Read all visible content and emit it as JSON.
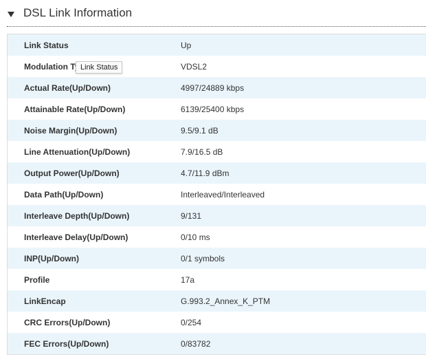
{
  "section": {
    "title": "DSL Link Information",
    "toggle_icon": "triangle-down-icon"
  },
  "rows": [
    {
      "label": "Link Status",
      "value": "Up"
    },
    {
      "label": "Modulation Type",
      "value": "VDSL2"
    },
    {
      "label": "Actual Rate(Up/Down)",
      "value": "4997/24889 kbps"
    },
    {
      "label": "Attainable Rate(Up/Down)",
      "value": "6139/25400 kbps"
    },
    {
      "label": "Noise Margin(Up/Down)",
      "value": "9.5/9.1 dB"
    },
    {
      "label": "Line Attenuation(Up/Down)",
      "value": "7.9/16.5 dB"
    },
    {
      "label": "Output Power(Up/Down)",
      "value": "4.7/11.9 dBm"
    },
    {
      "label": "Data Path(Up/Down)",
      "value": "Interleaved/Interleaved"
    },
    {
      "label": "Interleave Depth(Up/Down)",
      "value": "9/131"
    },
    {
      "label": "Interleave Delay(Up/Down)",
      "value": "0/10 ms"
    },
    {
      "label": "INP(Up/Down)",
      "value": "0/1 symbols"
    },
    {
      "label": "Profile",
      "value": "17a"
    },
    {
      "label": "LinkEncap",
      "value": "G.993.2_Annex_K_PTM"
    },
    {
      "label": "CRC Errors(Up/Down)",
      "value": "0/254"
    },
    {
      "label": "FEC Errors(Up/Down)",
      "value": "0/83782"
    }
  ],
  "tooltip": {
    "text": "Link Status"
  },
  "colors": {
    "row_stripe": "#eaf5fb",
    "row_plain": "#ffffff",
    "text": "#333333"
  }
}
